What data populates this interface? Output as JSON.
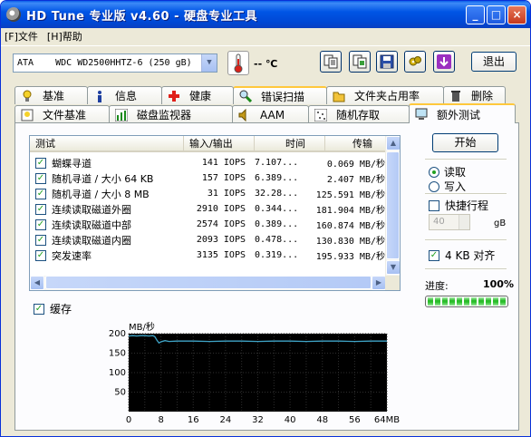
{
  "window": {
    "title": "HD Tune 专业版 v4.60 - 硬盘专业工具",
    "controls": {
      "minimize": "_",
      "maximize": "□",
      "close": "×"
    }
  },
  "menu": [
    {
      "label": "[F]文件"
    },
    {
      "label": "[H]帮助"
    }
  ],
  "toolbar": {
    "drive": "ATA    WDC WD2500HHTZ-6 (250 gB)",
    "temperature": "-- ℃",
    "exit_label": "退出",
    "icons": [
      "copy-info-icon",
      "copy-screen-icon",
      "save-icon",
      "settings-icon",
      "download-icon"
    ]
  },
  "tabs": {
    "row1": [
      {
        "label": "基准",
        "icon": "bulb-icon"
      },
      {
        "label": "信息",
        "icon": "info-icon"
      },
      {
        "label": "健康",
        "icon": "health-cross-icon"
      },
      {
        "label": "错误扫描",
        "icon": "magnifier-icon"
      },
      {
        "label": "文件夹占用率",
        "icon": "folder-icon"
      },
      {
        "label": "删除",
        "icon": "trash-icon"
      }
    ],
    "row2": [
      {
        "label": "文件基准",
        "icon": "file-bulb-icon"
      },
      {
        "label": "磁盘监视器",
        "icon": "chart-icon"
      },
      {
        "label": "AAM",
        "icon": "speaker-icon"
      },
      {
        "label": "随机存取",
        "icon": "dots-icon"
      },
      {
        "label": "额外测试",
        "icon": "monitor-icon"
      }
    ],
    "active": "额外测试"
  },
  "results": {
    "columns": [
      "测试",
      "输入/输出",
      "时间",
      "传输"
    ],
    "rows": [
      {
        "name": "蝴蝶寻道",
        "io": "141 IOPS",
        "time": "7.107...",
        "transfer": "0.069 MB/秒",
        "checked": true
      },
      {
        "name": "随机寻道 / 大小 64 KB",
        "io": "157 IOPS",
        "time": "6.389...",
        "transfer": "2.407 MB/秒",
        "checked": true
      },
      {
        "name": "随机寻道 / 大小 8 MB",
        "io": "31 IOPS",
        "time": "32.28...",
        "transfer": "125.591 MB/秒",
        "checked": true
      },
      {
        "name": "连续读取磁道外圈",
        "io": "2910 IOPS",
        "time": "0.344...",
        "transfer": "181.904 MB/秒",
        "checked": true
      },
      {
        "name": "连续读取磁道中部",
        "io": "2574 IOPS",
        "time": "0.389...",
        "transfer": "160.874 MB/秒",
        "checked": true
      },
      {
        "name": "连续读取磁道内圈",
        "io": "2093 IOPS",
        "time": "0.478...",
        "transfer": "130.830 MB/秒",
        "checked": true
      },
      {
        "name": "突发速率",
        "io": "3135 IOPS",
        "time": "0.319...",
        "transfer": "195.933 MB/秒",
        "checked": true
      }
    ]
  },
  "controls": {
    "start_label": "开始",
    "read_label": "读取",
    "write_label": "写入",
    "mode": "read",
    "quick_label": "快捷行程",
    "quick_checked": false,
    "quick_value": "40",
    "quick_unit": "gB",
    "align_label": "4 KB 对齐",
    "align_checked": true,
    "progress_label": "进度:",
    "progress_value": "100%",
    "progress_fraction": 1.0,
    "cache_label": "缓存",
    "cache_checked": true
  },
  "chart_data": {
    "type": "line",
    "title": "",
    "ylabel": "MB/秒",
    "xlabel": "",
    "x_unit": "MB",
    "ylim": [
      0,
      200
    ],
    "xlim": [
      0,
      64
    ],
    "yticks": [
      50,
      100,
      150,
      200
    ],
    "xticks": [
      0,
      4,
      8,
      12,
      16,
      20,
      24,
      28,
      32,
      36,
      40,
      44,
      48,
      52,
      56,
      60,
      64
    ],
    "xtick_labels": [
      "0",
      "",
      "8",
      "",
      "16",
      "",
      "24",
      "",
      "32",
      "",
      "40",
      "",
      "48",
      "",
      "56",
      "",
      "64MB"
    ],
    "grid": true,
    "background": "#000000",
    "line_color": "#3FA5C8",
    "series": [
      {
        "x": [
          0,
          1,
          2,
          3,
          4,
          5,
          6,
          6.5,
          7,
          7.5,
          8,
          9,
          10,
          12,
          16,
          20,
          24,
          28,
          32,
          36,
          40,
          44,
          48,
          52,
          56,
          60,
          64
        ],
        "values": [
          194,
          195,
          194,
          195,
          195,
          194,
          195,
          192,
          183,
          176,
          179,
          182,
          180,
          181,
          181,
          180,
          181,
          181,
          180,
          181,
          181,
          180,
          181,
          181,
          180,
          181,
          181
        ]
      }
    ]
  }
}
